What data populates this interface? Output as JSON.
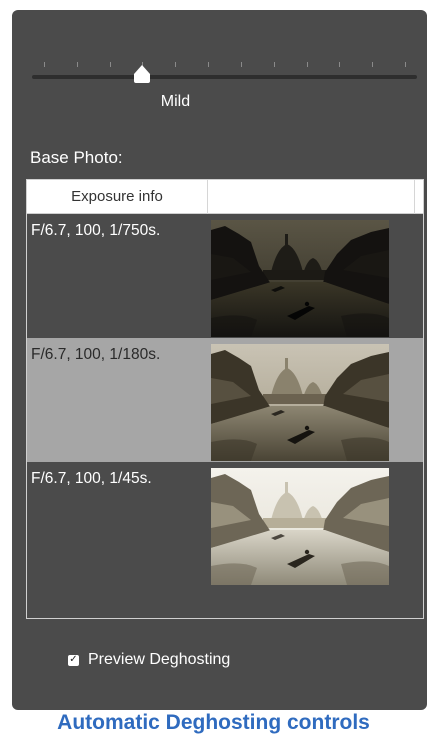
{
  "slider": {
    "tick_count": 12,
    "value_label": "Mild",
    "value_index": 3
  },
  "base_photo": {
    "label": "Base Photo:",
    "table": {
      "columns": [
        "Exposure info",
        ""
      ],
      "rows": [
        {
          "exposure": "F/6.7, 100, 1/750s.",
          "tone": "dark",
          "selected": false
        },
        {
          "exposure": "F/6.7, 100, 1/180s.",
          "tone": "mid",
          "selected": true
        },
        {
          "exposure": "F/6.7, 100, 1/45s.",
          "tone": "bright",
          "selected": false
        }
      ]
    }
  },
  "preview": {
    "label": "Preview Deghosting",
    "checked": true,
    "check_glyph": "✓"
  },
  "caption": "Automatic Deghosting controls",
  "colors": {
    "panel": "#4b4b4b",
    "selected_row": "#a6a6a6",
    "caption": "#2f6bbf"
  }
}
